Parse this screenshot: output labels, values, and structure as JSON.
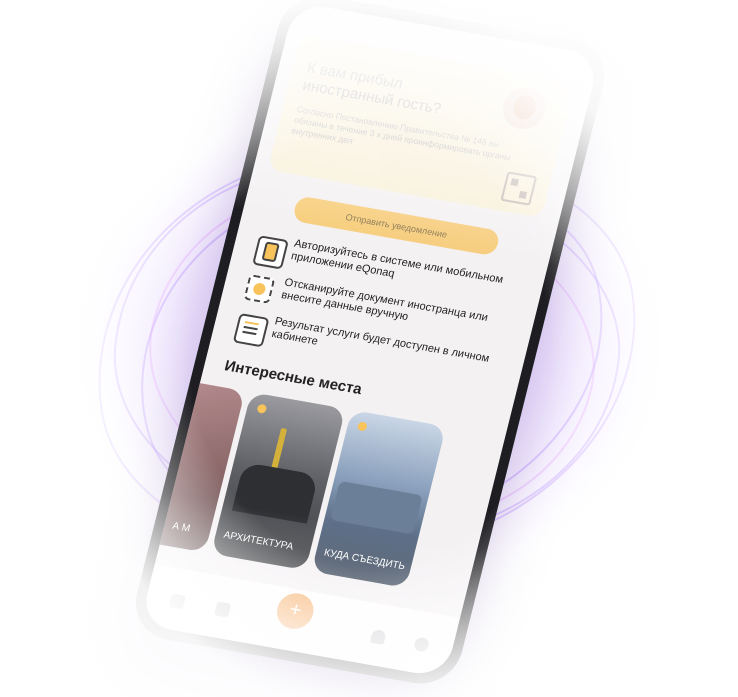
{
  "guest_card": {
    "title": "К вам прибыл иностранный гость?",
    "text": "Согласно Постановлению Правительства № 148 вы обязаны в течение 3 х дней проинформировать органы внутренних дел"
  },
  "send_button": "Отправить уведомление",
  "steps": [
    {
      "icon": "phone-icon",
      "text": "Авторизуйтесь в системе или мобильном приложении eQonaq"
    },
    {
      "icon": "scan-icon",
      "text": "Отсканируйте документ иностранца или внесите данные вручную"
    },
    {
      "icon": "document-icon",
      "text": "Результат услуги будет доступен в личном кабинете"
    }
  ],
  "places_title": "Интересные места",
  "places": [
    {
      "label": "А М"
    },
    {
      "label": "Архитектура"
    },
    {
      "label": "Куда съездить"
    }
  ],
  "nav": {
    "fab_label": "+",
    "items": [
      "home-icon",
      "document-icon",
      "bell-icon",
      "profile-icon"
    ]
  },
  "colors": {
    "accent": "#f8c35a",
    "fab": "#f6a55a",
    "wave": "#aa78ff"
  }
}
